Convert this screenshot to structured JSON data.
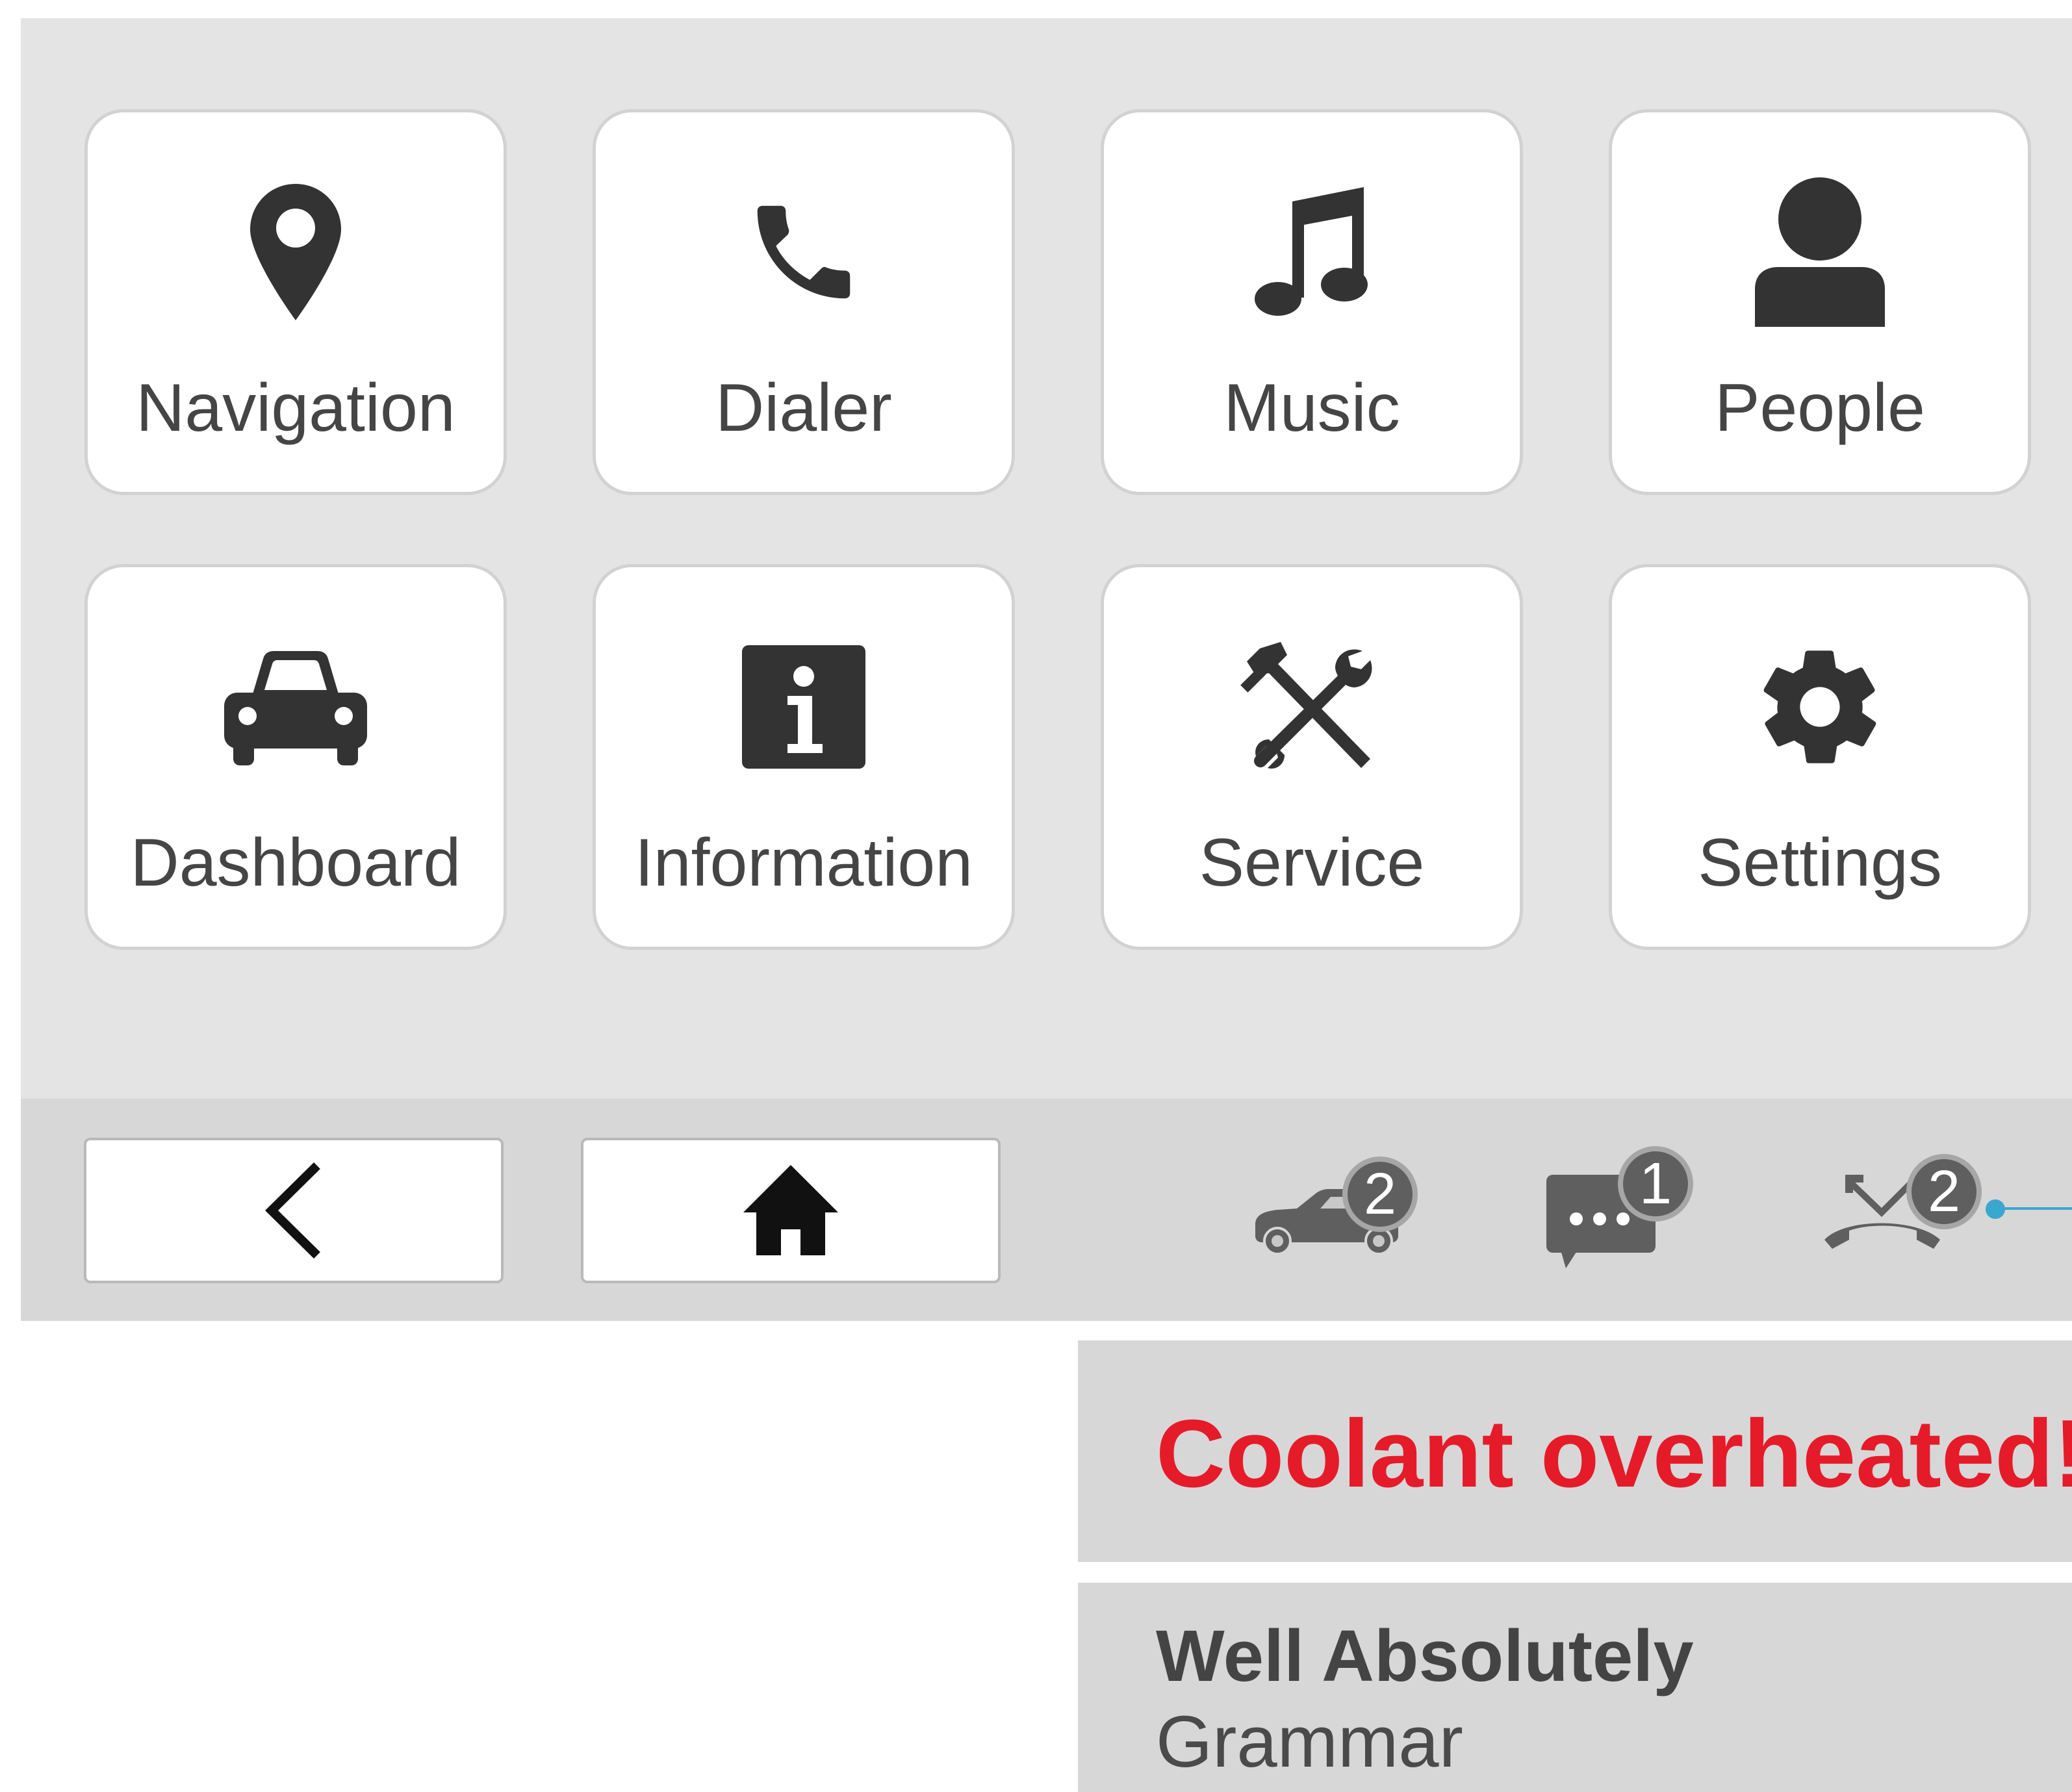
{
  "launcher": {
    "tiles": [
      {
        "label": "Navigation",
        "icon": "map-pin-icon"
      },
      {
        "label": "Dialer",
        "icon": "phone-icon"
      },
      {
        "label": "Music",
        "icon": "music-note-icon"
      },
      {
        "label": "People",
        "icon": "person-icon"
      },
      {
        "label": "Dashboard",
        "icon": "car-icon"
      },
      {
        "label": "Information",
        "icon": "info-icon"
      },
      {
        "label": "Service",
        "icon": "tools-icon"
      },
      {
        "label": "Settings",
        "icon": "gear-icon"
      }
    ]
  },
  "navbar": {
    "back_icon": "chevron-left-icon",
    "home_icon": "home-icon",
    "status": {
      "vehicle_count": "2",
      "messages_count": "1",
      "missed_calls_count": "2"
    }
  },
  "notifications": {
    "alert": "Coolant overheated!",
    "now_playing": {
      "title": "Well Absolutely",
      "artist": "Grammar"
    }
  },
  "colors": {
    "alert": "#e51b2a",
    "accent": "#3aa7cf",
    "icon": "#333333"
  }
}
